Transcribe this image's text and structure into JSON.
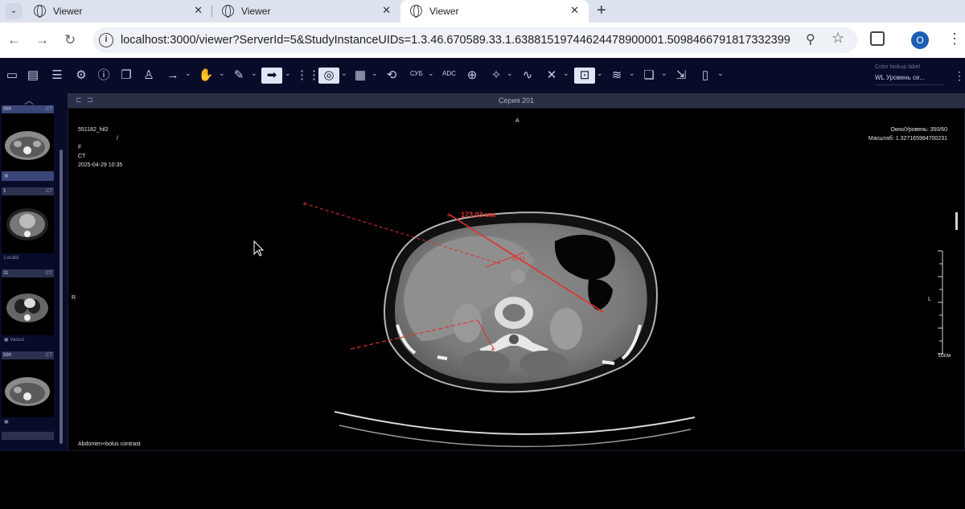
{
  "browser": {
    "tabs": [
      {
        "title": "Viewer",
        "active": false
      },
      {
        "title": "Viewer",
        "active": false
      },
      {
        "title": "Viewer",
        "active": true
      }
    ],
    "close_glyph": "✕",
    "new_tab_glyph": "+",
    "url": "localhost:3000/viewer?ServerId=5&StudyInstanceUIDs=1.3.46.670589.33.1.63881519744624478900001.5098466791817332399",
    "profile_initial": "O",
    "icons": {
      "back": "←",
      "forward": "→",
      "reload": "↻",
      "info": "i",
      "zoom": "⚲",
      "star": "☆",
      "menu": "⋮",
      "dropdown": "⌄"
    }
  },
  "toolbar": {
    "icons": [
      "folder-icon",
      "save-icon",
      "list-icon",
      "settings-sliders-icon",
      "info-circle-icon",
      "series-stack-icon",
      "anonymize-icon",
      "arrow-icon",
      "pan-hand-icon",
      "ruler-icon",
      "window-level-icon",
      "grid-icon",
      "magnify-search-icon",
      "sort-icon",
      "reset-icon"
    ],
    "cyb_label": "СУБ",
    "adc_label": "ADC",
    "color_lookup_label": "Color lookup label",
    "color_lookup_value": "WL Уровень се...",
    "dropdown_caret": "⌄",
    "accent_color": "#dfe5f5",
    "background_color": "#090c29"
  },
  "side_panel": {
    "thumbnails": [
      {
        "left": "999",
        "right": "CT",
        "footer": "",
        "selected": true
      },
      {
        "left": "1",
        "right": "CT",
        "footer": "Localiz",
        "selected": false
      },
      {
        "left": "11",
        "right": "CT",
        "footer": "Vascul",
        "selected": false
      },
      {
        "left": "500",
        "right": "CT",
        "footer": "",
        "selected": false
      },
      {
        "left": "",
        "right": "",
        "footer": "",
        "selected": false
      }
    ]
  },
  "viewport": {
    "series_title": "Серия 201",
    "top_left": [
      "551182_hil2",
      "/",
      "F",
      "CT",
      "2025-04-29 10:35"
    ],
    "top_right": [
      "Окно/Уровень: 350/60",
      "Масштаб: 1.327165984700231"
    ],
    "orientation_top": "A",
    "orientation_left": "R",
    "orientation_right": "L",
    "scale_label": "10см",
    "bottom_left": "Abdomen+bolus contrast",
    "measurement_label": "173.03 мм",
    "small_label": "10.11",
    "measure_color": "#e0312b"
  }
}
